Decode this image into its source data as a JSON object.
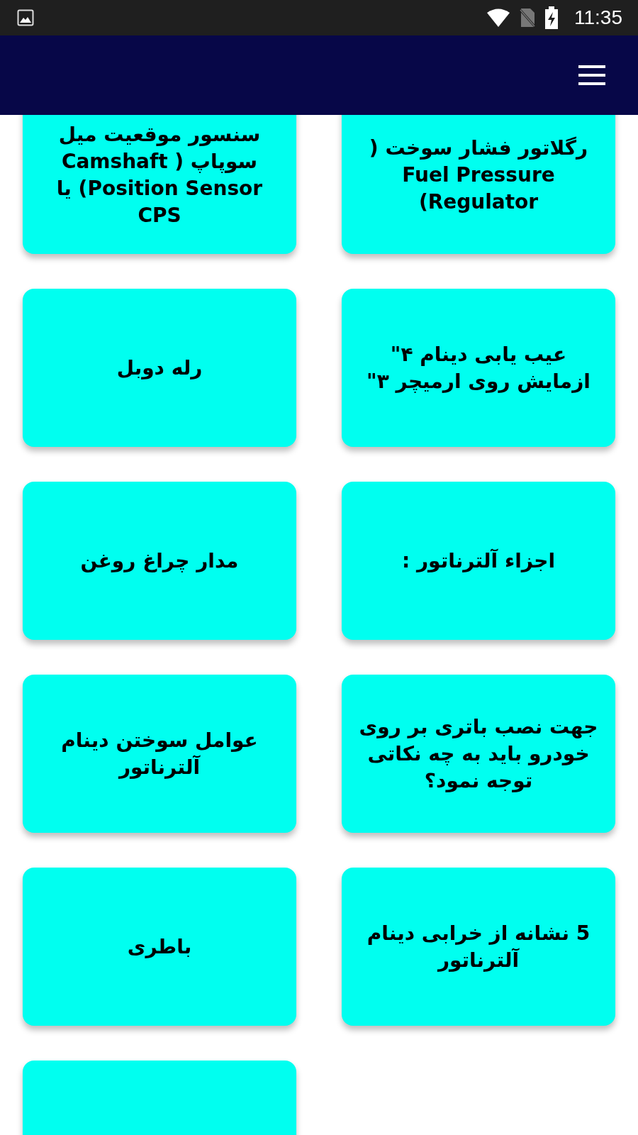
{
  "status_bar": {
    "time": "11:35"
  },
  "cards": [
    {
      "kind": "titled",
      "title": "رگلاتور فشار سوخت ( Fuel Pressure Regulator)"
    },
    {
      "kind": "titled",
      "title": "سنسور موقعیت میل سوپاپ ( Camshaft Position Sensor) یا CPS"
    },
    {
      "kind": "titled",
      "title": "عیب یابی دینام ۴\" ازمایش روی ارمیچر ۳\""
    },
    {
      "kind": "titled",
      "title": "رله دوبل"
    },
    {
      "kind": "titled",
      "title": "اجزاء آلترناتور :"
    },
    {
      "kind": "titled",
      "title": "مدار چراغ روغن"
    },
    {
      "kind": "titled",
      "title": "جهت نصب باتری بر روی خودرو باید به چه نکاتی توجه نمود؟"
    },
    {
      "kind": "titled",
      "title": "عوامل سوختن دینام آلترناتور"
    },
    {
      "kind": "titled",
      "title": "5 نشانه از خرابی دینام آلترناتور"
    },
    {
      "kind": "titled",
      "title": "باطری"
    },
    {
      "kind": "blank"
    }
  ]
}
